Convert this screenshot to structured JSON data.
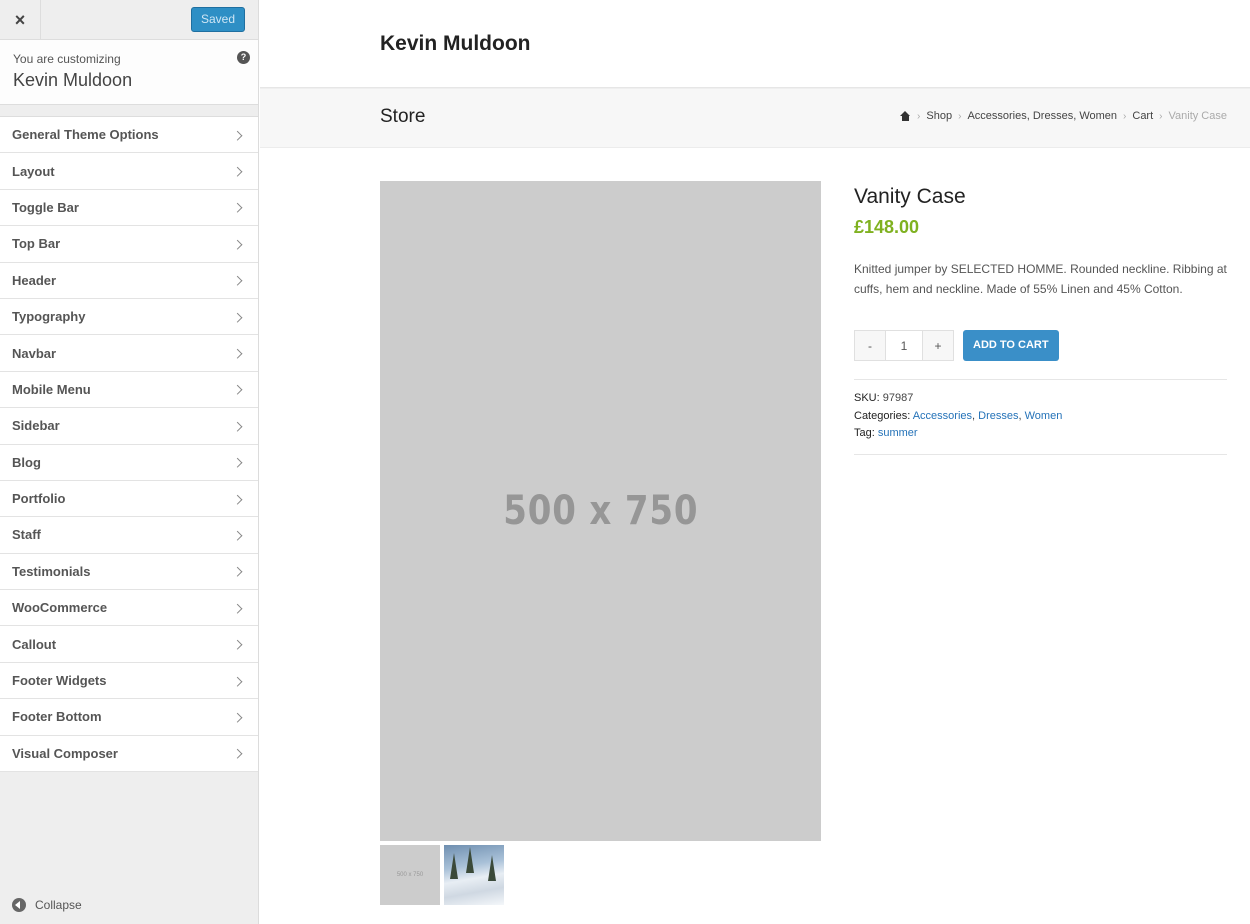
{
  "sidebar": {
    "close_label": "×",
    "saved_label": "Saved",
    "customizing_label": "You are customizing",
    "site_name": "Kevin Muldoon",
    "help_label": "?",
    "items": [
      {
        "label": "General Theme Options"
      },
      {
        "label": "Layout"
      },
      {
        "label": "Toggle Bar"
      },
      {
        "label": "Top Bar"
      },
      {
        "label": "Header"
      },
      {
        "label": "Typography"
      },
      {
        "label": "Navbar"
      },
      {
        "label": "Mobile Menu"
      },
      {
        "label": "Sidebar"
      },
      {
        "label": "Blog"
      },
      {
        "label": "Portfolio"
      },
      {
        "label": "Staff"
      },
      {
        "label": "Testimonials"
      },
      {
        "label": "WooCommerce"
      },
      {
        "label": "Callout"
      },
      {
        "label": "Footer Widgets"
      },
      {
        "label": "Footer Bottom"
      },
      {
        "label": "Visual Composer"
      }
    ],
    "collapse_label": "Collapse"
  },
  "site": {
    "title": "Kevin Muldoon",
    "page_title": "Store"
  },
  "breadcrumb": {
    "shop": "Shop",
    "accessories": "Accessories",
    "dresses": "Dresses",
    "women": "Women",
    "cart": "Cart",
    "current": "Vanity Case",
    "comma": ","
  },
  "product": {
    "image_placeholder": "500 x 750",
    "thumb_placeholder": "500 x 750",
    "title": "Vanity Case",
    "price": "£148.00",
    "description": "Knitted jumper by SELECTED HOMME. Rounded neckline. Ribbing at cuffs, hem and neckline. Made of 55% Linen and 45% Cotton.",
    "qty_minus": "-",
    "qty_value": "1",
    "qty_plus": "+",
    "add_to_cart": "ADD TO CART",
    "sku_label": "SKU:",
    "sku": "97987",
    "categories_label": "Categories:",
    "categories": [
      "Accessories",
      "Dresses",
      "Women"
    ],
    "tag_label": "Tag:",
    "tag": "summer"
  },
  "colors": {
    "accent": "#2e8fc5",
    "price": "#7fb120",
    "link": "#2472b8"
  }
}
